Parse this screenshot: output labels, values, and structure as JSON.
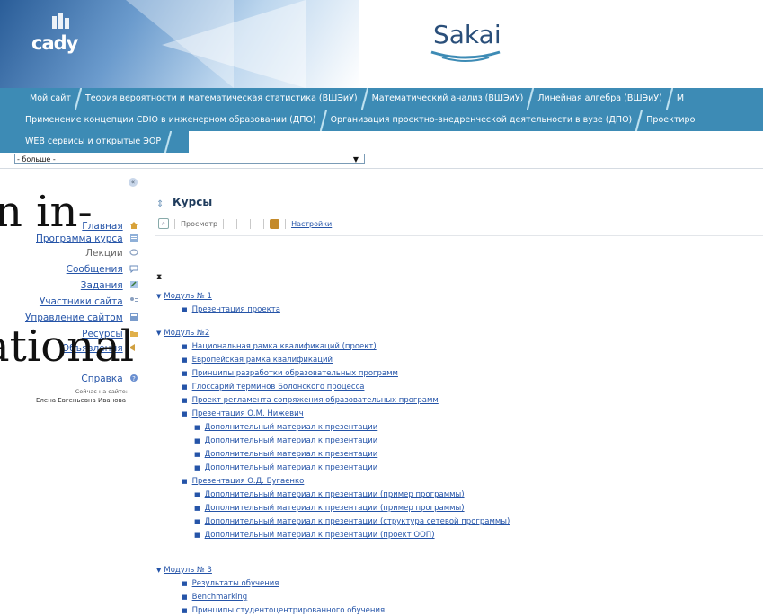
{
  "header": {
    "cady_logo_text": "cady",
    "sakai_logo_text": "Sakai"
  },
  "tabs_row1": [
    "Мой сайт",
    "Теория вероятности и математическая статистика (ВШЭиУ)",
    "Математический анализ (ВШЭиУ)",
    "Линейная алгебра (ВШЭиУ)",
    "М"
  ],
  "tabs_row2": [
    "Применение концепции CDIO в инженерном образовании (ДПО)",
    "Организация проектно-внедренческой деятельности в вузе (ДПО)",
    "Проектиро"
  ],
  "tabs_row3": [
    "WEB сервисы и открытые ЭОР"
  ],
  "more_select": {
    "value": "- больше -",
    "arrow": "▼"
  },
  "sidebar": {
    "collapse_icon": "«",
    "items": [
      {
        "label": "Главная",
        "link": true,
        "icon": "home-icon"
      },
      {
        "label": "Программа курса",
        "link": true,
        "icon": "syllabus-icon"
      },
      {
        "label": "Лекции",
        "link": false,
        "icon": "lessons-icon"
      },
      {
        "label": "Сообщения",
        "link": true,
        "icon": "messages-icon"
      },
      {
        "label": "Задания",
        "link": true,
        "icon": "assignments-icon"
      },
      {
        "label": "Участники сайта",
        "link": true,
        "icon": "roster-icon"
      },
      {
        "label": "Управление сайтом",
        "link": true,
        "icon": "site-info-icon"
      },
      {
        "label": "Ресурсы",
        "link": true,
        "icon": "resources-icon"
      },
      {
        "label": "Объявления",
        "link": true,
        "icon": "announcements-icon"
      },
      {
        "label": "Справка",
        "link": true,
        "icon": "help-icon"
      }
    ],
    "online_label": "Сейчас на сайте:",
    "online_user": "Елена Евгеньевна Иванова"
  },
  "overlay": {
    "line1": "n in-",
    "line2": "ational"
  },
  "main": {
    "title": "Курсы",
    "toolbar": {
      "view_label": "Просмотр",
      "settings_label": "Настройки"
    },
    "expand_icon": "⧗",
    "modules": [
      {
        "title": "Модуль № 1",
        "items": [
          {
            "label": "Презентация проекта",
            "link": true,
            "children": []
          }
        ]
      },
      {
        "title": "Модуль №2",
        "items": [
          {
            "label": "Национальная рамка квалификаций (проект)",
            "link": true,
            "children": []
          },
          {
            "label": "Европейская рамка квалификаций",
            "link": true,
            "children": []
          },
          {
            "label": "Принципы разработки образовательных программ",
            "link": true,
            "children": []
          },
          {
            "label": "Глоссарий терминов Болонского процесса",
            "link": true,
            "children": []
          },
          {
            "label": "Проект регламента сопряжения образовательных программ",
            "link": true,
            "children": []
          },
          {
            "label": "Презентация О.М. Нижевич",
            "link": true,
            "children": [
              "Дополнительный материал к презентации",
              "Дополнительный материал к презентации",
              "Дополнительный материал к презентации",
              "Дополнительный материал к презентации"
            ]
          },
          {
            "label": "Презентация О.Д. Бугаенко",
            "link": true,
            "children": [
              "Дополнительный материал к презентации (пример программы)",
              "Дополнительный материал к презентации (пример программы)",
              "Дополнительный материал к презентации (структура сетевой программы)",
              "Дополнительный материал к презентации (проект ООП)"
            ]
          }
        ]
      },
      {
        "title": "Модуль № 3",
        "items": [
          {
            "label": "Результаты обучения",
            "link": true,
            "children": []
          },
          {
            "label": "Benchmarking",
            "link": true,
            "children": []
          },
          {
            "label": "Принципы студентоцентрированного обучения",
            "link": false,
            "children": []
          }
        ]
      }
    ]
  },
  "colors": {
    "tab_bar": "#3d8bb5",
    "link": "#2554a8",
    "title": "#1f3c5d"
  }
}
